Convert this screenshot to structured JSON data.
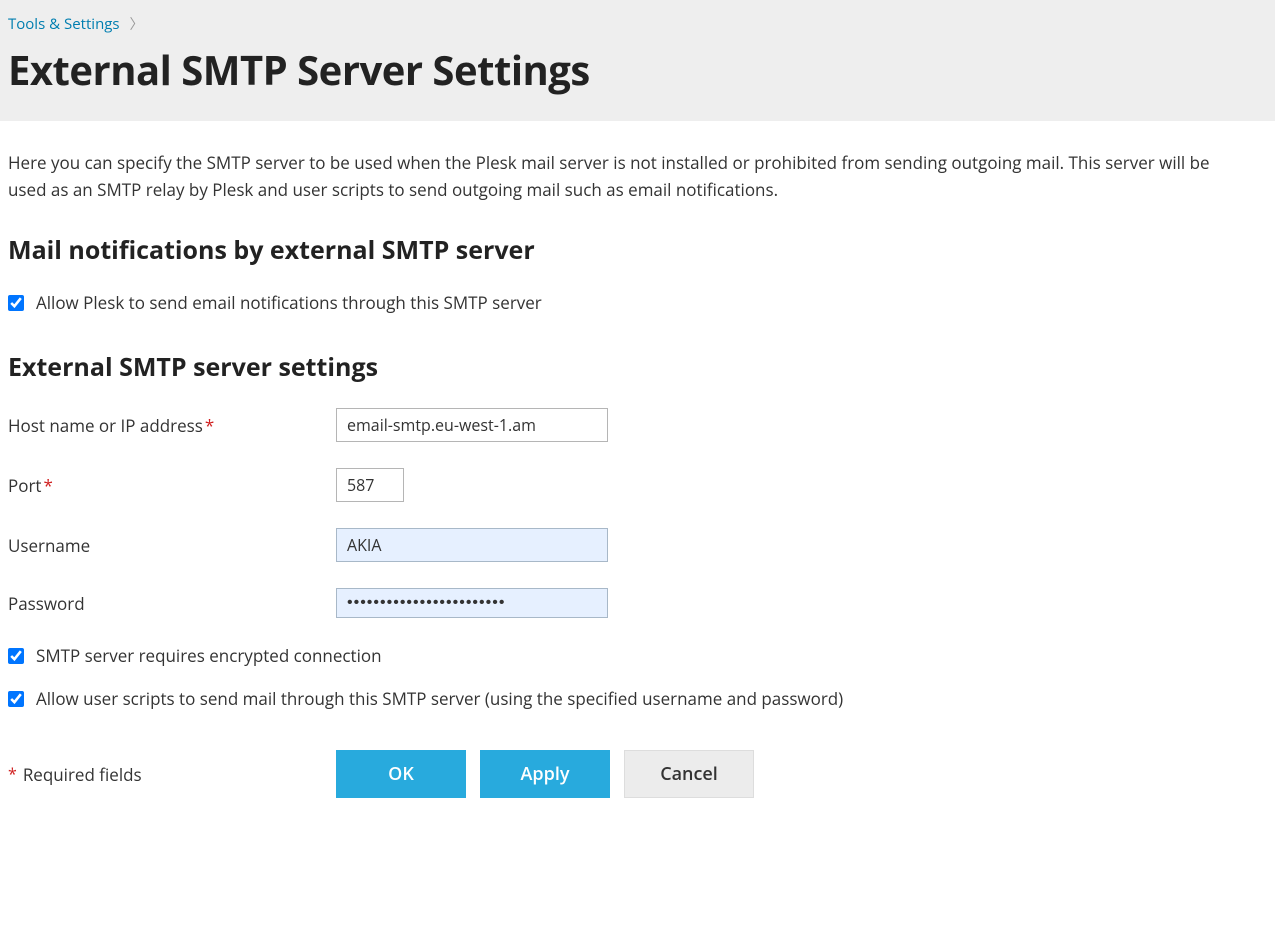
{
  "breadcrumb": {
    "parent": "Tools & Settings"
  },
  "page_title": "External SMTP Server Settings",
  "intro_text": "Here you can specify the SMTP server to be used when the Plesk mail server is not installed or prohibited from sending outgoing mail. This server will be used as an SMTP relay by Plesk and user scripts to send outgoing mail such as email notifications.",
  "section1": {
    "heading": "Mail notifications by external SMTP server",
    "allow_notifications_label": "Allow Plesk to send email notifications through this SMTP server"
  },
  "section2": {
    "heading": "External SMTP server settings",
    "host_label": "Host name or IP address",
    "host_value": "email-smtp.eu-west-1.am",
    "port_label": "Port",
    "port_value": "587",
    "username_label": "Username",
    "username_value": "AKIA",
    "password_label": "Password",
    "password_value": "••••••••••••••••••••••••",
    "encrypted_label": "SMTP server requires encrypted connection",
    "allow_scripts_label": "Allow user scripts to send mail through this SMTP server (using the specified username and password)"
  },
  "required_fields_label": "Required fields",
  "buttons": {
    "ok": "OK",
    "apply": "Apply",
    "cancel": "Cancel"
  }
}
